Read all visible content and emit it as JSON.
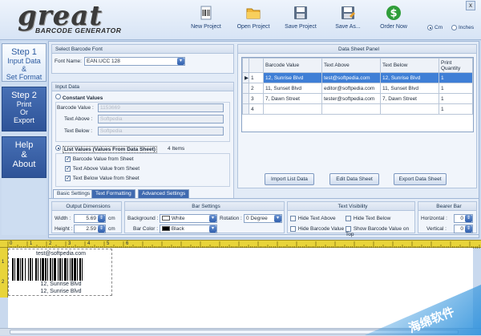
{
  "app": {
    "logo_main": "great",
    "logo_sub": "BARCODE GENERATOR"
  },
  "toolbar": {
    "new": "New Project",
    "open": "Open Project",
    "save": "Save Project",
    "save_as": "Save As...",
    "order": "Order Now",
    "unit_cm": "Cm",
    "unit_in": "Inches",
    "close": "x"
  },
  "sidebar": {
    "step1": {
      "title": "Step 1",
      "l1": "Input Data",
      "l2": "&",
      "l3": "Set Format"
    },
    "step2": {
      "title": "Step 2",
      "l1": "Print",
      "l2": "Or",
      "l3": "Export"
    },
    "step3": {
      "l1": "Help",
      "l2": "&",
      "l3": "About"
    }
  },
  "font_section": {
    "title": "Select Barcode Font",
    "label": "Font Name:",
    "value": "EAN.UCC 128"
  },
  "input_section": {
    "title": "Input Data",
    "constant_label": "Constant Values",
    "barcode_label": "Barcode Value :",
    "barcode_value": "1153669",
    "above_label": "Text Above :",
    "above_value": "Softpedia",
    "below_label": "Text Below :",
    "below_value": "Softpedia",
    "list_label": "List Values (Values From Data Sheet)",
    "items": "4 Items",
    "opt1": "Barcode Value from Sheet",
    "opt2": "Text Above Value from Sheet",
    "opt3": "Text Below Value from Sheet"
  },
  "datasheet": {
    "title": "Data Sheet Panel",
    "headers": [
      "",
      "",
      "Barcode Value",
      "Text Above",
      "Text Below",
      "Print Quantity"
    ],
    "rows": [
      {
        "marker": "▶",
        "n": "1",
        "barcode": "12, Sunrise Blvd",
        "above": "test@softpedia.com",
        "below": "12, Sunrise Blvd",
        "qty": "1"
      },
      {
        "marker": "",
        "n": "2",
        "barcode": "11, Sunset Blvd",
        "above": "editor@softpedia.com",
        "below": "11, Sunset Blvd",
        "qty": "1"
      },
      {
        "marker": "",
        "n": "3",
        "barcode": "7, Dawn Street",
        "above": "tester@softpedia.com",
        "below": "7, Dawn Street",
        "qty": "1"
      },
      {
        "marker": "",
        "n": "4",
        "barcode": "",
        "above": "",
        "below": "",
        "qty": "1"
      }
    ],
    "import_btn": "Import List Data",
    "edit_btn": "Edit Data Sheet",
    "export_btn": "Export Data Sheet"
  },
  "tabs": [
    "Basic Settings",
    "Text Formatting",
    "Advanced Settings"
  ],
  "output": {
    "title": "Output Dimensions",
    "width_label": "Width :",
    "width_value": "5.69",
    "height_label": "Height :",
    "height_value": "2.59",
    "unit": "cm"
  },
  "bar_settings": {
    "title": "Bar Settings",
    "bg_label": "Background :",
    "bg_value": "White",
    "rotation_label": "Rotation :",
    "rotation_value": "0 Degree",
    "color_label": "Bar Color :",
    "color_value": "Black"
  },
  "visibility": {
    "title": "Text Visibility",
    "hide_above": "Hide Text Above",
    "hide_below": "Hide Text Below",
    "hide_barcode": "Hide Barcode Value",
    "show_on_top": "Show Barcode Value on Top"
  },
  "bearer": {
    "title": "Bearer Bar",
    "horizontal_label": "Horizontal :",
    "horizontal_value": "0",
    "vertical_label": "Vertical :",
    "vertical_value": "0"
  },
  "preview": {
    "text_above": "test@softpedia.com",
    "value_line": "12, Sunrise Blvd",
    "text_below": "12, Sunrise Blvd"
  },
  "ruler_top": [
    "0",
    "1",
    "2",
    "3",
    "4",
    "5",
    "6"
  ],
  "ruler_left": [
    "1",
    "2"
  ],
  "watermark": "海绵软件",
  "colors": {
    "accent": "#2e5398",
    "selection": "#3f7fd6",
    "ruler": "#e8d43a"
  }
}
